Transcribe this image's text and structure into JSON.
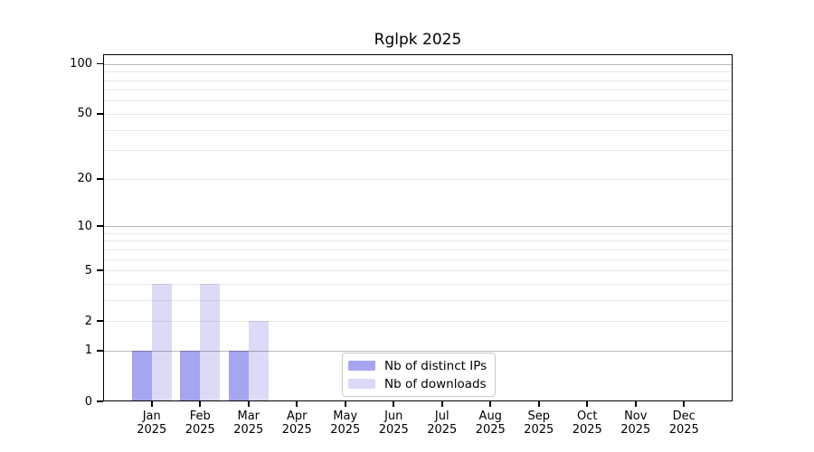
{
  "chart_data": {
    "type": "bar",
    "title": "Rglpk 2025",
    "categories": [
      "Jan",
      "Feb",
      "Mar",
      "Apr",
      "May",
      "Jun",
      "Jul",
      "Aug",
      "Sep",
      "Oct",
      "Nov",
      "Dec"
    ],
    "year": "2025",
    "series": [
      {
        "name": "Nb of distinct IPs",
        "color": "#a5a5f0",
        "values": [
          1,
          1,
          1,
          0,
          0,
          0,
          0,
          0,
          0,
          0,
          0,
          0
        ]
      },
      {
        "name": "Nb of downloads",
        "color": "#dbdbf7",
        "values": [
          4,
          4,
          2,
          0,
          0,
          0,
          0,
          0,
          0,
          0,
          0,
          0
        ]
      }
    ],
    "xlabel": "",
    "ylabel": "",
    "y_axis": {
      "scale": "log10(1+x)",
      "ylim": [
        0,
        115
      ],
      "tick_labels": [
        100,
        50,
        20,
        10,
        5,
        2,
        1,
        0
      ],
      "major_gridlines": [
        1,
        10,
        100
      ],
      "minor_gridlines": [
        2,
        3,
        4,
        5,
        6,
        7,
        8,
        9,
        20,
        30,
        40,
        50,
        60,
        70,
        80,
        90
      ]
    },
    "grid": true,
    "legend": {
      "position": "inside-bottom-center",
      "entries": [
        "Nb of distinct IPs",
        "Nb of downloads"
      ]
    },
    "colors": {
      "distinct_ips_bar": "#a5a5f0",
      "downloads_bar": "#dbdbf7",
      "major_grid": "#bababa",
      "minor_grid": "#e8e8e8",
      "axis": "#000000",
      "background": "#ffffff"
    }
  }
}
